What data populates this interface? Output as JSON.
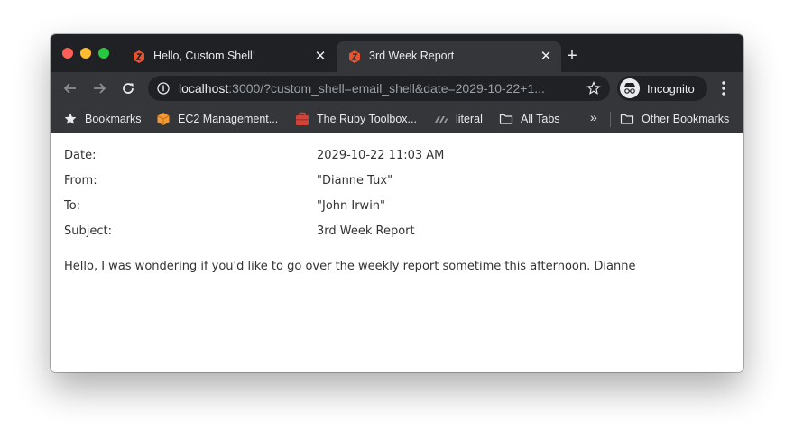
{
  "tabs": [
    {
      "title": "Hello, Custom Shell!",
      "active": false
    },
    {
      "title": "3rd Week Report",
      "active": true
    }
  ],
  "toolbar": {
    "url_host": "localhost",
    "url_rest": ":3000/?custom_shell=email_shell&date=2029-10-22+1...",
    "incognito_label": "Incognito"
  },
  "bookmarks": [
    {
      "label": "Bookmarks",
      "icon": "star-icon"
    },
    {
      "label": "EC2 Management...",
      "icon": "aws-box-icon"
    },
    {
      "label": "The Ruby Toolbox...",
      "icon": "ruby-toolbox-icon"
    },
    {
      "label": "literal",
      "icon": "literal-icon"
    },
    {
      "label": "All Tabs",
      "icon": "folder-icon"
    },
    {
      "label": "Other Bookmarks",
      "icon": "folder-icon"
    }
  ],
  "overflow_label": "»",
  "email": {
    "fields": [
      {
        "label": "Date:",
        "value": "2029-10-22 11:03 AM"
      },
      {
        "label": "From:",
        "value": "\"Dianne Tux\""
      },
      {
        "label": "To:",
        "value": "\"John Irwin\""
      },
      {
        "label": "Subject:",
        "value": "3rd Week Report"
      }
    ],
    "body": "Hello, I was wondering if you'd like to go over the weekly report sometime this afternoon. Dianne"
  },
  "colors": {
    "tab_bar": "#202124",
    "toolbar": "#35363a",
    "favicon": "#e8532f"
  }
}
